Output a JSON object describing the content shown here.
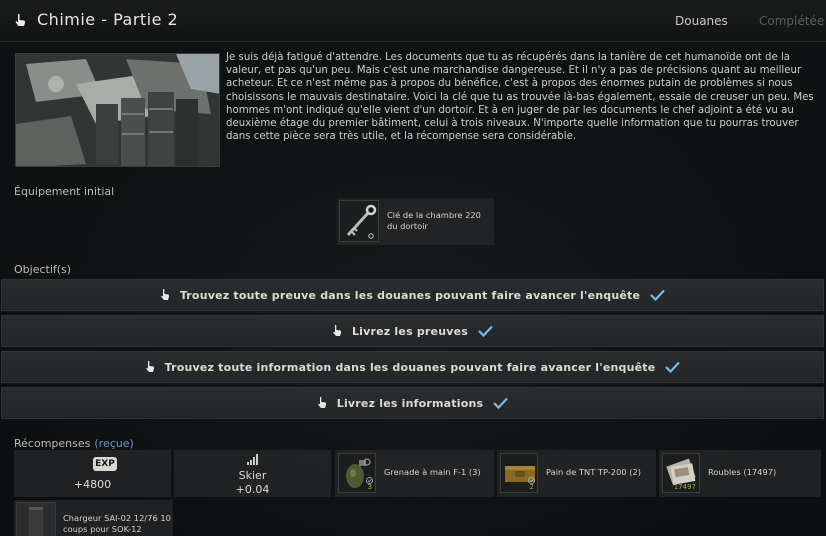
{
  "header": {
    "title": "Chimie - Partie 2",
    "location": "Douanes",
    "status": "Complétée"
  },
  "description": "Je suis déjà fatigué d'attendre. Les documents que tu as récupérés dans la tanière de cet humanoïde ont de la valeur, et pas qu'un peu. Mais c'est une marchandise dangereuse. Et il n'y a pas de précisions quant au meilleur acheteur. Et ce n'est même pas à propos du bénéfice, c'est à propos des énormes putain de problèmes si nous choisissons le mauvais destinataire. Voici la clé que tu as trouvée là-bas également, essaie de creuser un peu. Mes hommes m'ont indiqué qu'elle vient d'un dortoir. Et à en juger de par les documents le chef adjoint a été vu au deuxième étage du premier bâtiment, celui à trois niveaux. N'importe quelle information que tu pourras trouver dans cette pièce sera très utile, et la récompense sera considérable.",
  "equipment": {
    "label": "Équipement initial",
    "item": {
      "name": "Clé de la chambre 220 du dortoir",
      "icon": "key-icon"
    }
  },
  "objectives": {
    "label": "Objectif(s)",
    "items": [
      {
        "text": "Trouvez toute preuve dans les douanes pouvant faire avancer l'enquête",
        "done": true
      },
      {
        "text": "Livrez les preuves",
        "done": true
      },
      {
        "text": "Trouvez toute information dans les douanes pouvant faire avancer l'enquête",
        "done": true
      },
      {
        "text": "Livrez les informations",
        "done": true
      }
    ]
  },
  "rewards": {
    "label": "Récompenses",
    "received": "(reçue)",
    "exp": {
      "badge": "EXP",
      "value": "+4800"
    },
    "skill": {
      "name": "Skier",
      "value": "+0.04",
      "icon": "signal-bars-icon"
    },
    "items": [
      {
        "name": "Grenade à main F-1 (3)",
        "count": "3",
        "icon": "grenade-icon"
      },
      {
        "name": "Pain de TNT TP-200 (2)",
        "count": "2",
        "icon": "tnt-block-icon"
      },
      {
        "name": "Roubles (17497)",
        "count": "17497",
        "icon": "roubles-icon"
      }
    ],
    "row2": {
      "name": "Chargeur SAI-02 12/76 10 coups pour SOK-12",
      "icon": "magazine-icon"
    }
  },
  "colors": {
    "accent_blue": "#6f98c9",
    "check": "#79b8e8",
    "count_green": "#8fbc3a"
  }
}
